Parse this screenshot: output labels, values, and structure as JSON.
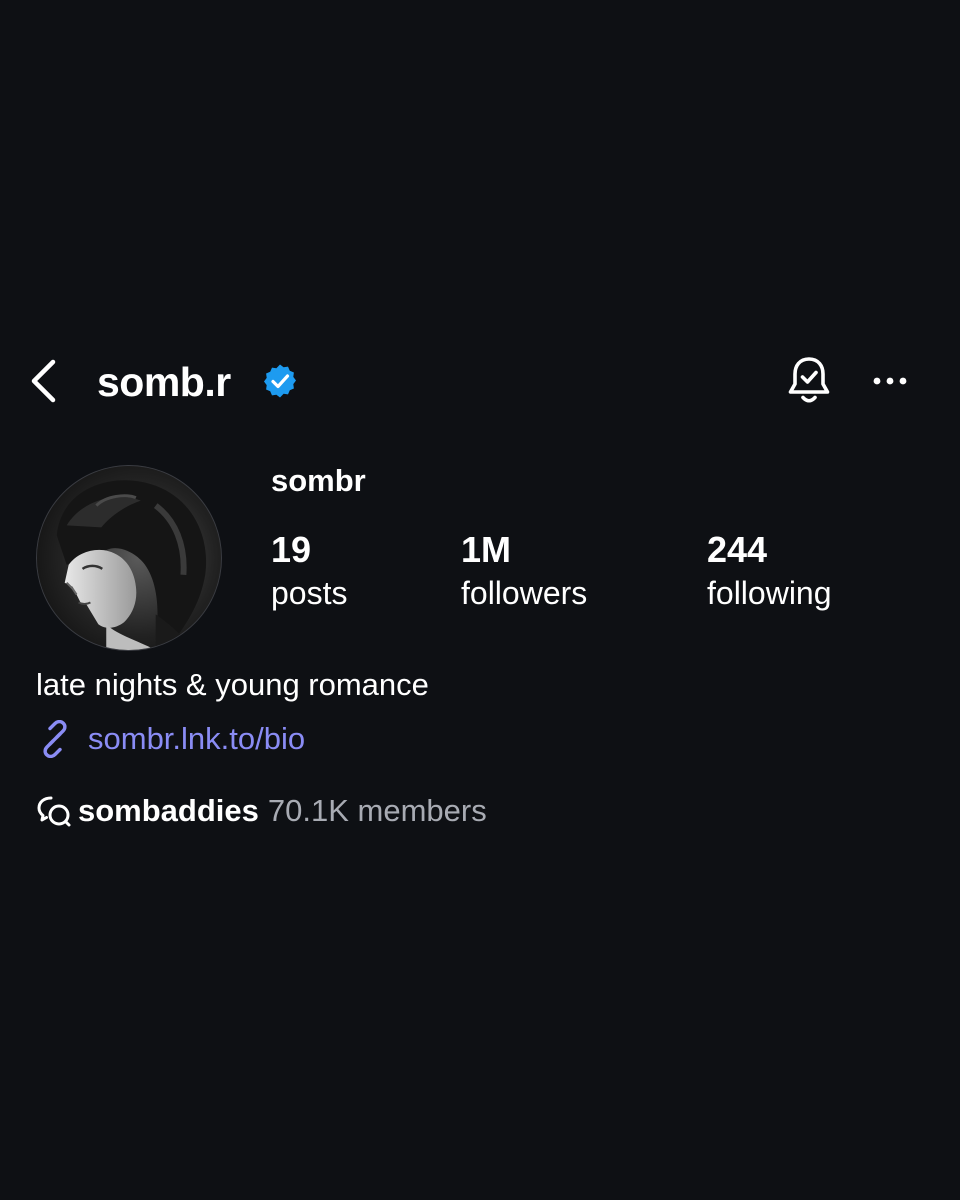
{
  "header": {
    "handle": "somb.r",
    "verified": true,
    "back_icon": "chevron-left-icon",
    "bell_icon": "bell-check-icon",
    "more_icon": "more-horizontal-icon"
  },
  "profile": {
    "display_name": "sombr",
    "avatar_icon": "profile-photo"
  },
  "stats": {
    "posts": {
      "value": "19",
      "label": "posts"
    },
    "followers": {
      "value": "1M",
      "label": "followers"
    },
    "following": {
      "value": "244",
      "label": "following"
    }
  },
  "bio": {
    "text": "late nights & young romance",
    "link": "sombr.lnk.to/bio",
    "link_icon": "link-icon"
  },
  "channel": {
    "name": "sombaddies",
    "members": "70.1K members",
    "icon": "broadcast-channel-icon"
  },
  "colors": {
    "background": "#0e1014",
    "text": "#ffffff",
    "link": "#8a8cf5",
    "verified": "#1d9bf0",
    "muted": "#a8abb3"
  }
}
